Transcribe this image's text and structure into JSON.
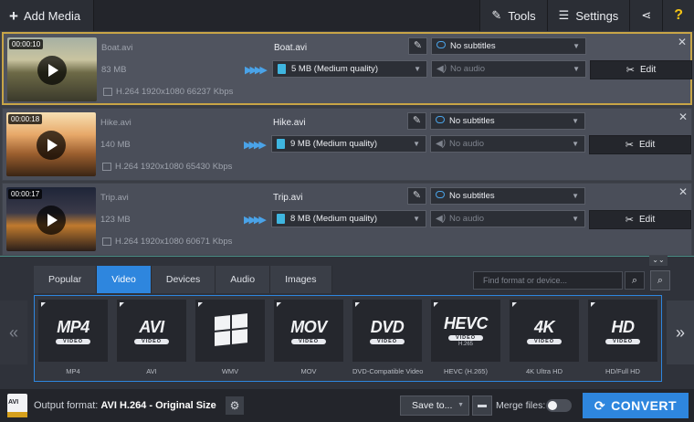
{
  "topbar": {
    "add_media": "Add Media",
    "tools": "Tools",
    "settings": "Settings",
    "help": "?"
  },
  "files": [
    {
      "duration": "00:00:10",
      "src_name": "Boat.avi",
      "src_size": "83 MB",
      "src_info": "H.264 1920x1080 66237 Kbps",
      "out_name": "Boat.avi",
      "out_size": "5 MB (Medium quality)",
      "subtitles": "No subtitles",
      "audio": "No audio",
      "edit": "Edit"
    },
    {
      "duration": "00:00:18",
      "src_name": "Hike.avi",
      "src_size": "140 MB",
      "src_info": "H.264 1920x1080 65430 Kbps",
      "out_name": "Hike.avi",
      "out_size": "9 MB (Medium quality)",
      "subtitles": "No subtitles",
      "audio": "No audio",
      "edit": "Edit"
    },
    {
      "duration": "00:00:17",
      "src_name": "Trip.avi",
      "src_size": "123 MB",
      "src_info": "H.264 1920x1080 60671 Kbps",
      "out_name": "Trip.avi",
      "out_size": "8 MB (Medium quality)",
      "subtitles": "No subtitles",
      "audio": "No audio",
      "edit": "Edit"
    }
  ],
  "format_panel": {
    "tabs": [
      "Popular",
      "Video",
      "Devices",
      "Audio",
      "Images"
    ],
    "active_tab": "Video",
    "search_placeholder": "Find format or device...",
    "formats": [
      {
        "big": "MP4",
        "pill": "VIDEO",
        "label": "MP4"
      },
      {
        "big": "AVI",
        "pill": "VIDEO",
        "label": "AVI"
      },
      {
        "big": "",
        "pill": "",
        "label": "WMV",
        "icon": "windows-logo"
      },
      {
        "big": "MOV",
        "pill": "VIDEO",
        "label": "MOV"
      },
      {
        "big": "DVD",
        "pill": "VIDEO",
        "label": "DVD-Compatible Video"
      },
      {
        "big": "HEVC",
        "pill": "VIDEO",
        "sub": "H.265",
        "label": "HEVC (H.265)"
      },
      {
        "big": "4K",
        "pill": "VIDEO",
        "label": "4K Ultra HD"
      },
      {
        "big": "HD",
        "pill": "VIDEO",
        "label": "HD/Full HD"
      }
    ]
  },
  "bottombar": {
    "icon_text": "AVI",
    "output_label": "Output format:",
    "output_value": "AVI H.264 - Original Size",
    "save_to": "Save to...",
    "merge_files": "Merge files:",
    "convert": "CONVERT"
  },
  "colors": {
    "accent": "#2e86de",
    "selected_border": "#c8a547",
    "help": "#f3c316"
  }
}
